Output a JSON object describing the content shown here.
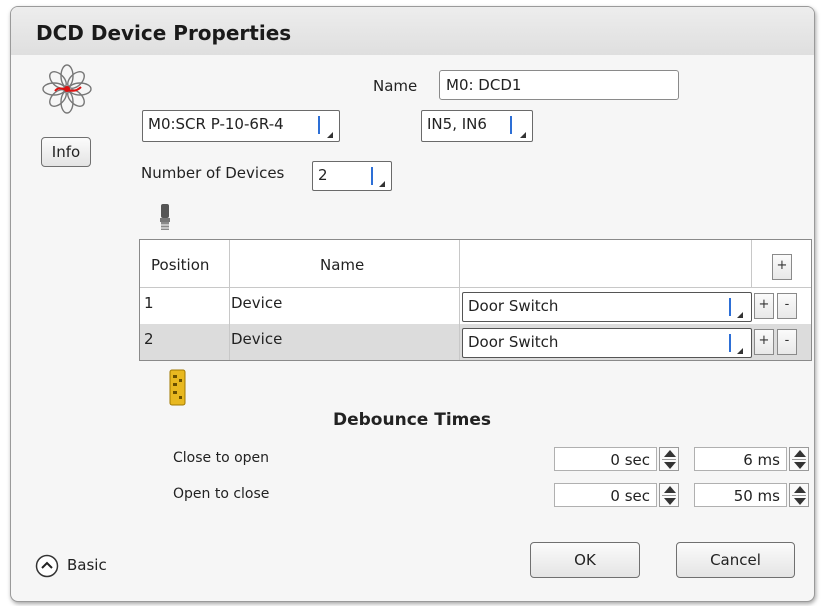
{
  "dialog": {
    "title": "DCD Device Properties"
  },
  "info_button": "Info",
  "name": {
    "label": "Name",
    "value": "M0: DCD1"
  },
  "module_combo": {
    "value": "M0:SCR P-10-6R-4"
  },
  "inputs_combo": {
    "value": "IN5, IN6"
  },
  "num_devices": {
    "label": "Number of Devices",
    "value": "2"
  },
  "table": {
    "headers": [
      "Position",
      "Name",
      ""
    ],
    "add_label": "+",
    "rows": [
      {
        "position": "1",
        "name": "Device",
        "type": "Door Switch",
        "plus": "+",
        "minus": "-"
      },
      {
        "position": "2",
        "name": "Device",
        "type": "Door Switch",
        "plus": "+",
        "minus": "-"
      }
    ]
  },
  "debounce": {
    "title": "Debounce Times",
    "close_to_open": {
      "label": "Close to open",
      "sec": "0 sec",
      "ms": "6 ms"
    },
    "open_to_close": {
      "label": "Open to close",
      "sec": "0 sec",
      "ms": "50 ms"
    }
  },
  "footer": {
    "basic_label": "Basic",
    "ok_label": "OK",
    "cancel_label": "Cancel"
  },
  "colors": {
    "accent": "#2d6fd6",
    "selected_row": "#dcdcdc",
    "title_bg": "#e6e6e6"
  }
}
